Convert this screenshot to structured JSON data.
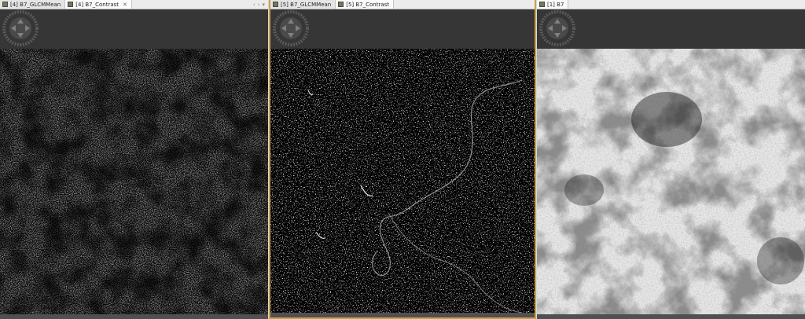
{
  "panes": [
    {
      "tabs": [
        {
          "label": "[4] B7_GLCMMean",
          "active": false
        },
        {
          "label": "[4] B7_Contrast",
          "active": true
        }
      ]
    },
    {
      "tabs": [
        {
          "label": "[5] B7_GLCMMean",
          "active": false
        },
        {
          "label": "[5] B7_Contrast",
          "active": true
        }
      ]
    },
    {
      "tabs": [
        {
          "label": "[1] B7",
          "active": true
        }
      ]
    }
  ],
  "tab_nav": {
    "left": "‹",
    "right": "›",
    "menu": "▾"
  },
  "icons": {
    "tab_icon": "raster-band-icon",
    "close": "close-icon",
    "nav": "navigation-wheel-icon"
  },
  "colors": {
    "active_pane_border": "#c8a24a",
    "view_bg": "#363636",
    "tab_bg": "#ececec"
  }
}
